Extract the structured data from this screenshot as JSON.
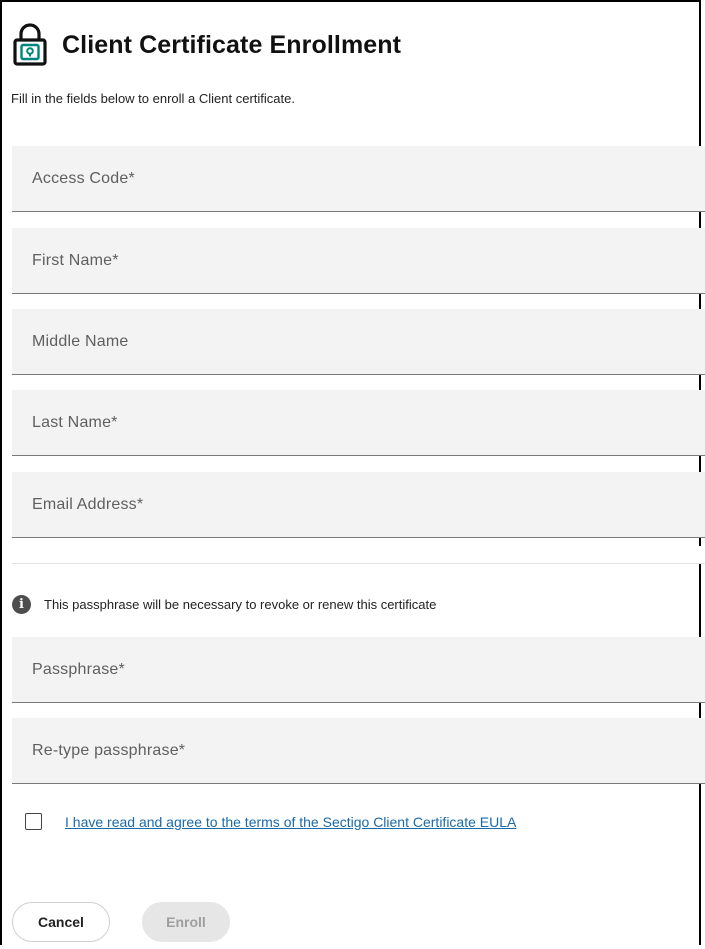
{
  "header": {
    "title": "Client Certificate Enrollment",
    "icon": "lock-icon",
    "icon_color": "#00857a"
  },
  "subtitle": "Fill in the fields below to enroll a Client certificate.",
  "fields": {
    "access_code": {
      "placeholder": "Access Code*",
      "value": ""
    },
    "first_name": {
      "placeholder": "First Name*",
      "value": ""
    },
    "middle_name": {
      "placeholder": "Middle Name",
      "value": ""
    },
    "last_name": {
      "placeholder": "Last Name*",
      "value": ""
    },
    "email": {
      "placeholder": "Email Address*",
      "value": ""
    },
    "passphrase": {
      "placeholder": "Passphrase*",
      "value": ""
    },
    "retype_passphrase": {
      "placeholder": "Re-type passphrase*",
      "value": ""
    }
  },
  "info": {
    "icon": "info-icon",
    "icon_glyph": "i",
    "text": "This passphrase will be necessary to revoke or renew this certificate"
  },
  "eula": {
    "checked": false,
    "link_text": "I have read and agree to the terms of the Sectigo Client Certificate EULA",
    "link_color": "#1a6aa8"
  },
  "buttons": {
    "cancel_label": "Cancel",
    "enroll_label": "Enroll",
    "enroll_disabled": true
  }
}
